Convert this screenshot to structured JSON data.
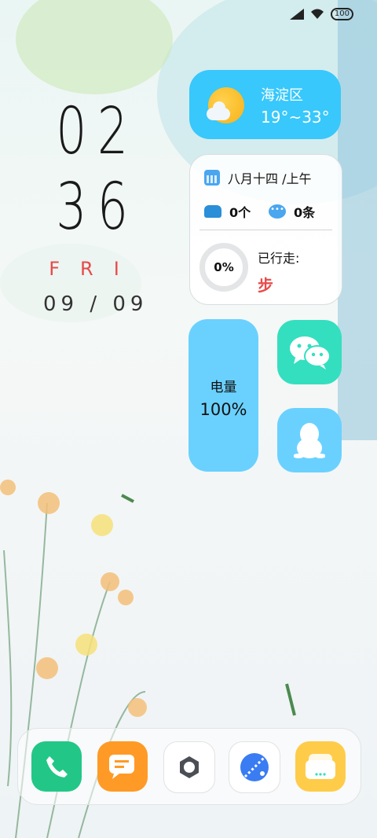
{
  "status_bar": {
    "battery_level": "100"
  },
  "clock": {
    "hours": "02",
    "minutes": "36",
    "day": "FRI",
    "date": "09 / 09"
  },
  "weather_widget": {
    "location": "海淀区",
    "temperature_range": "19°~33°",
    "icon": "partly-sunny-icon"
  },
  "info_widget": {
    "lunar_date": "八月十四 /上午",
    "missed_calls": "0个",
    "messages": "0条",
    "step_progress": "0%",
    "step_label": "已行走:",
    "step_unit": "步"
  },
  "battery_widget": {
    "label": "电量",
    "value": "100%"
  },
  "apps": [
    {
      "name": "wechat-icon"
    },
    {
      "name": "qq-icon"
    }
  ],
  "dock": [
    {
      "name": "phone-icon"
    },
    {
      "name": "messages-icon"
    },
    {
      "name": "settings-icon"
    },
    {
      "name": "browser-icon"
    },
    {
      "name": "files-icon"
    }
  ],
  "colors": {
    "weather_widget": "#38c8fb",
    "battery_widget": "#6ad1ff",
    "wechat": "#34dfc0",
    "accent_red": "#e84a4a"
  }
}
